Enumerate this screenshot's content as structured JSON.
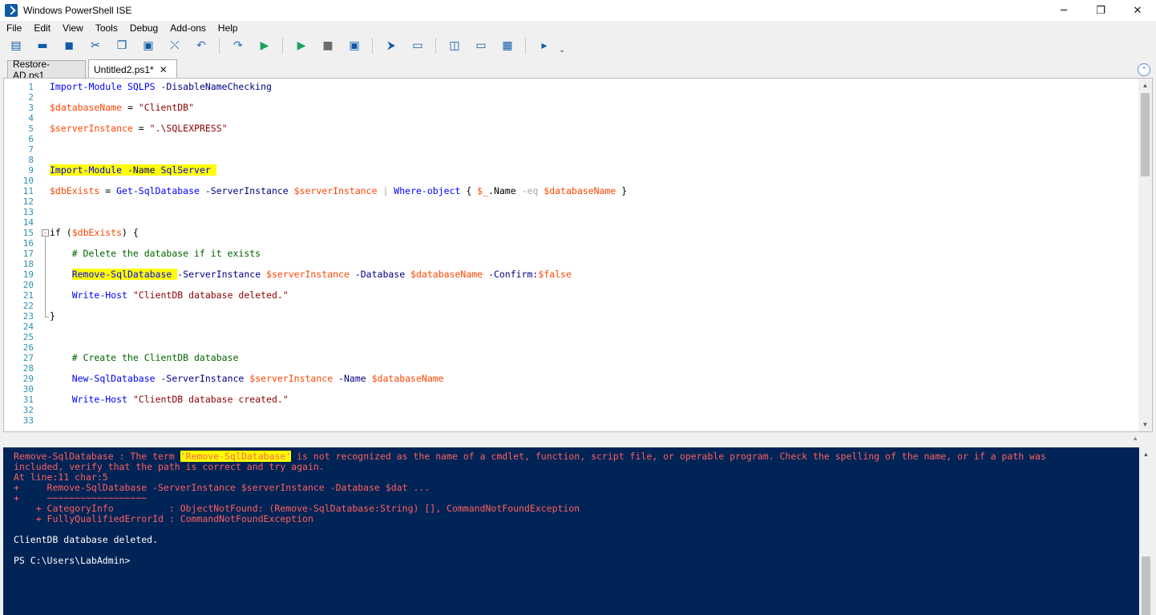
{
  "window": {
    "title": "Windows PowerShell ISE",
    "controls": {
      "minimize": "─",
      "maximize": "❐",
      "close": "✕"
    }
  },
  "menu": [
    "File",
    "Edit",
    "View",
    "Tools",
    "Debug",
    "Add-ons",
    "Help"
  ],
  "toolbar": {
    "buttons": [
      {
        "name": "new-file-icon",
        "glyph": "▤"
      },
      {
        "name": "open-folder-icon",
        "glyph": "▬"
      },
      {
        "name": "save-icon",
        "glyph": "◼"
      },
      {
        "name": "cut-icon",
        "glyph": "✂"
      },
      {
        "name": "copy-icon",
        "glyph": "❐"
      },
      {
        "name": "paste-icon",
        "glyph": "▣"
      },
      {
        "name": "clear-console-icon",
        "glyph": "⤬"
      },
      {
        "name": "undo-icon",
        "glyph": "↶"
      },
      {
        "name": "redo-icon",
        "glyph": "↷"
      },
      {
        "name": "run-script-icon",
        "glyph": "▶"
      },
      {
        "name": "run-selection-icon",
        "glyph": "▶"
      },
      {
        "name": "stop-icon",
        "glyph": "■"
      },
      {
        "name": "remote-powershell-icon",
        "glyph": "▣"
      },
      {
        "name": "start-powershell-icon",
        "glyph": "⮞"
      },
      {
        "name": "show-script-pane-top-icon",
        "glyph": "▭"
      },
      {
        "name": "show-script-pane-right-icon",
        "glyph": "◫"
      },
      {
        "name": "show-script-pane-max-icon",
        "glyph": "▭"
      },
      {
        "name": "show-command-window-icon",
        "glyph": "▦"
      },
      {
        "name": "show-command-addon-icon",
        "glyph": "▸"
      }
    ],
    "overflow": "⌄",
    "colors": {
      "run": "#1aa260",
      "stop": "#6d6d6d",
      "undo": "#2a6ebf",
      "accent": "#0e5aa6"
    }
  },
  "tabs": [
    {
      "label": "Restore-AD.ps1",
      "active": false
    },
    {
      "label": "Untitled2.ps1*",
      "active": true,
      "close": "✕"
    }
  ],
  "collapse_glyph": "⌃",
  "editor": {
    "line_numbers": [
      "1",
      "2",
      "3",
      "4",
      "5",
      "6",
      "7",
      "8",
      "9",
      "10",
      "11",
      "12",
      "13",
      "14",
      "15",
      "16",
      "17",
      "18",
      "19",
      "20",
      "21",
      "22",
      "23",
      "24",
      "25",
      "26",
      "27",
      "28",
      "29",
      "30",
      "31",
      "32",
      "33"
    ],
    "lines": [
      [
        {
          "t": "Import-Module",
          "c": "cmd"
        },
        {
          "t": " SQLPS",
          "c": "cmd"
        },
        {
          "t": " -DisableNameChecking",
          "c": "param"
        }
      ],
      [],
      [
        {
          "t": "$databaseName",
          "c": "var"
        },
        {
          "t": " = ",
          "c": "gray"
        },
        {
          "t": "\"ClientDB\"",
          "c": "str"
        }
      ],
      [],
      [
        {
          "t": "$serverInstance",
          "c": "var"
        },
        {
          "t": " = ",
          "c": "gray"
        },
        {
          "t": "\".\\SQLEXPRESS\"",
          "c": "str"
        }
      ],
      [],
      [],
      [],
      [
        {
          "t": "Import-Module",
          "c": "cmd",
          "h": true
        },
        {
          "t": " -Name",
          "c": "param",
          "h": true
        },
        {
          "t": " SqlServer",
          "c": "cmd",
          "h": true
        },
        {
          "t": " ",
          "c": "gray",
          "h": true
        }
      ],
      [],
      [
        {
          "t": "$dbExists",
          "c": "var"
        },
        {
          "t": " = ",
          "c": "gray"
        },
        {
          "t": "Get-SqlDatabase",
          "c": "cmd"
        },
        {
          "t": " -ServerInstance",
          "c": "param"
        },
        {
          "t": " $serverInstance",
          "c": "var"
        },
        {
          "t": " | ",
          "c": "op"
        },
        {
          "t": "Where-object",
          "c": "cmd"
        },
        {
          "t": " { ",
          "c": "gray"
        },
        {
          "t": "$_",
          "c": "var"
        },
        {
          "t": ".Name",
          "c": "gray"
        },
        {
          "t": " -eq",
          "c": "op"
        },
        {
          "t": " $databaseName",
          "c": "var"
        },
        {
          "t": " }",
          "c": "gray"
        }
      ],
      [],
      [],
      [],
      [
        {
          "t": "if",
          "c": "gray"
        },
        {
          "t": " (",
          "c": "gray"
        },
        {
          "t": "$dbExists",
          "c": "var"
        },
        {
          "t": ") {",
          "c": "gray"
        }
      ],
      [],
      [
        {
          "t": "    # Delete the database if it exists",
          "c": "com"
        }
      ],
      [],
      [
        {
          "t": "    ",
          "c": "gray"
        },
        {
          "t": "Remove-SqlDatabase",
          "c": "cmd",
          "h": true
        },
        {
          "t": " ",
          "c": "gray",
          "h": true
        },
        {
          "t": "-ServerInstance",
          "c": "param"
        },
        {
          "t": " $serverInstance",
          "c": "var"
        },
        {
          "t": " -Database",
          "c": "param"
        },
        {
          "t": " $databaseName",
          "c": "var"
        },
        {
          "t": " -Confirm:",
          "c": "param"
        },
        {
          "t": "$false",
          "c": "var"
        }
      ],
      [],
      [
        {
          "t": "    ",
          "c": "gray"
        },
        {
          "t": "Write-Host",
          "c": "cmd"
        },
        {
          "t": " \"ClientDB database deleted.\"",
          "c": "str"
        }
      ],
      [],
      [
        {
          "t": "}",
          "c": "gray"
        }
      ],
      [],
      [],
      [],
      [
        {
          "t": "    # Create the ClientDB database",
          "c": "com"
        }
      ],
      [],
      [
        {
          "t": "    ",
          "c": "gray"
        },
        {
          "t": "New-SqlDatabase",
          "c": "cmd"
        },
        {
          "t": " -ServerInstance",
          "c": "param"
        },
        {
          "t": " $serverInstance",
          "c": "var"
        },
        {
          "t": " -Name",
          "c": "param"
        },
        {
          "t": " $databaseName",
          "c": "var"
        }
      ],
      [],
      [
        {
          "t": "    ",
          "c": "gray"
        },
        {
          "t": "Write-Host",
          "c": "cmd"
        },
        {
          "t": " \"ClientDB database created.\"",
          "c": "str"
        }
      ],
      [],
      []
    ]
  },
  "console": {
    "lines": [
      [
        {
          "t": "Remove-SqlDatabase : The term ",
          "c": "err"
        },
        {
          "t": "'Remove-SqlDatabase'",
          "c": "errhl"
        },
        {
          "t": " is not recognized as the name of a cmdlet, function, script file, or operable program. Check the spelling of the name, or if a path was",
          "c": "err"
        }
      ],
      [
        {
          "t": "included, verify that the path is correct and try again.",
          "c": "err"
        }
      ],
      [
        {
          "t": "At line:11 char:5",
          "c": "err"
        }
      ],
      [
        {
          "t": "+     Remove-SqlDatabase -ServerInstance $serverInstance -Database $dat ...",
          "c": "err"
        }
      ],
      [
        {
          "t": "+     ~~~~~~~~~~~~~~~~~~",
          "c": "err"
        }
      ],
      [
        {
          "t": "    + CategoryInfo          : ObjectNotFound: (Remove-SqlDatabase:String) [], CommandNotFoundException",
          "c": "err"
        }
      ],
      [
        {
          "t": "    + FullyQualifiedErrorId : CommandNotFoundException",
          "c": "err"
        }
      ],
      [
        {
          "t": " ",
          "c": "out"
        }
      ],
      [
        {
          "t": "ClientDB database deleted.",
          "c": "out"
        }
      ],
      [
        {
          "t": " ",
          "c": "out"
        }
      ],
      [
        {
          "t": "PS C:\\Users\\LabAdmin>",
          "c": "out"
        }
      ]
    ]
  }
}
